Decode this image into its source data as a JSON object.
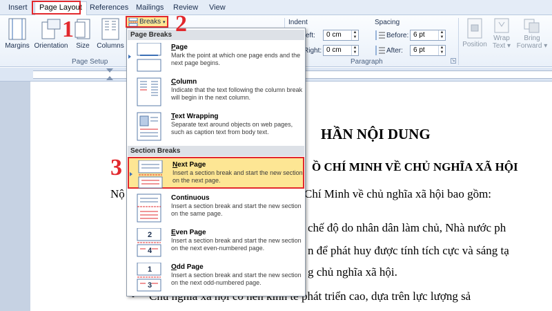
{
  "ribbon_tabs": [
    "Insert",
    "Page Layout",
    "References",
    "Mailings",
    "Review",
    "View"
  ],
  "active_tab": "Page Layout",
  "ribbon": {
    "margins": "Margins",
    "orientation": "Orientation",
    "size": "Size",
    "columns": "Columns",
    "breaks": "Breaks",
    "page_setup_group": "Page Setup",
    "indent_label": "Indent",
    "indent_left_label": "eft:",
    "indent_left_value": "0 cm",
    "indent_right_label": "Right:",
    "indent_right_value": "0 cm",
    "spacing_label": "Spacing",
    "spacing_before_label": "Before:",
    "spacing_before_value": "6 pt",
    "spacing_after_label": "After:",
    "spacing_after_value": "6 pt",
    "paragraph_group": "Paragraph",
    "position": "Position",
    "wrap_text_1": "Wrap",
    "wrap_text_2": "Text",
    "bring_forward_1": "Bring",
    "bring_forward_2": "Forward"
  },
  "steps": {
    "one": "1",
    "two": "2",
    "three": "3"
  },
  "breaks_menu": {
    "page_breaks_header": "Page Breaks",
    "section_breaks_header": "Section Breaks",
    "items": [
      {
        "title_u": "P",
        "title_rest": "age",
        "desc": "Mark the point at which one page ends and the next page begins."
      },
      {
        "title_u": "C",
        "title_rest": "olumn",
        "desc": "Indicate that the text following the column break will begin in the next column."
      },
      {
        "title_u": "T",
        "title_rest": "ext Wrapping",
        "desc": "Separate text around objects on web pages, such as caption text from body text."
      },
      {
        "title_u": "N",
        "title_rest": "ext Page",
        "desc": "Insert a section break and start the new section on the next page."
      },
      {
        "title_u": "",
        "title_rest": "Continuous",
        "desc": "Insert a section break and start the new section on the same page."
      },
      {
        "title_u": "E",
        "title_rest": "ven Page",
        "desc": "Insert a section break and start the new section on the next even-numbered page."
      },
      {
        "title_u": "O",
        "title_rest": "dd Page",
        "desc": "Insert a section break and start the new section on the next odd-numbered page."
      }
    ],
    "even_icon_num": "2",
    "even_icon_num2": "4",
    "odd_icon_num": "1",
    "odd_icon_num2": "3"
  },
  "document": {
    "heading": "HẦN NỘI DUNG",
    "subheading": "Ồ CHÍ MINH VỀ CHỦ NGHĨA XÃ HỘI",
    "line1_left": "Nộ",
    "line1_right": "Chí Minh về chủ nghĩa xã hội bao gồm:",
    "line2": "chế độ do nhân dân làm chủ, Nhà nước ph",
    "line3": "n để phát huy được tính tích cực và sáng tạ",
    "line4": "g chủ nghĩa xã hội.",
    "line5": "Chủ nghĩa xã hội có nền kinh tế phát triển cao, dựa trên lực lượng sả"
  }
}
